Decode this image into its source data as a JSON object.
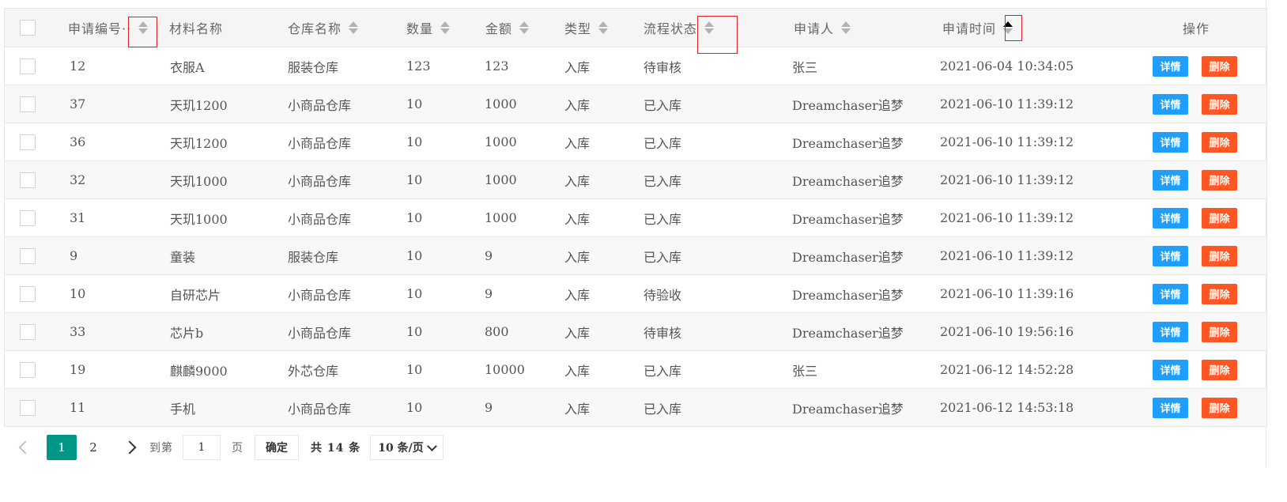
{
  "columns": {
    "id": "申请编号··",
    "material": "材料名称",
    "warehouse": "仓库名称",
    "qty": "数量",
    "amount": "金额",
    "type": "类型",
    "status": "流程状态",
    "applicant": "申请人",
    "time": "申请时间",
    "ops": "操作"
  },
  "rows": [
    {
      "id": "12",
      "material": "衣服A",
      "warehouse": "服装仓库",
      "qty": "123",
      "amount": "123",
      "type": "入库",
      "status": "待审核",
      "applicant": "张三",
      "time": "2021-06-04 10:34:05"
    },
    {
      "id": "37",
      "material": "天玑1200",
      "warehouse": "小商品仓库",
      "qty": "10",
      "amount": "1000",
      "type": "入库",
      "status": "已入库",
      "applicant": "Dreamchaser追梦",
      "time": "2021-06-10 11:39:12"
    },
    {
      "id": "36",
      "material": "天玑1200",
      "warehouse": "小商品仓库",
      "qty": "10",
      "amount": "1000",
      "type": "入库",
      "status": "已入库",
      "applicant": "Dreamchaser追梦",
      "time": "2021-06-10 11:39:12"
    },
    {
      "id": "32",
      "material": "天玑1000",
      "warehouse": "小商品仓库",
      "qty": "10",
      "amount": "1000",
      "type": "入库",
      "status": "已入库",
      "applicant": "Dreamchaser追梦",
      "time": "2021-06-10 11:39:12"
    },
    {
      "id": "31",
      "material": "天玑1000",
      "warehouse": "小商品仓库",
      "qty": "10",
      "amount": "1000",
      "type": "入库",
      "status": "已入库",
      "applicant": "Dreamchaser追梦",
      "time": "2021-06-10 11:39:12"
    },
    {
      "id": "9",
      "material": "童装",
      "warehouse": "服装仓库",
      "qty": "10",
      "amount": "9",
      "type": "入库",
      "status": "已入库",
      "applicant": "Dreamchaser追梦",
      "time": "2021-06-10 11:39:12"
    },
    {
      "id": "10",
      "material": "自研芯片",
      "warehouse": "小商品仓库",
      "qty": "10",
      "amount": "9",
      "type": "入库",
      "status": "待验收",
      "applicant": "Dreamchaser追梦",
      "time": "2021-06-10 11:39:16"
    },
    {
      "id": "33",
      "material": "芯片b",
      "warehouse": "小商品仓库",
      "qty": "10",
      "amount": "800",
      "type": "入库",
      "status": "待审核",
      "applicant": "Dreamchaser追梦",
      "time": "2021-06-10 19:56:16"
    },
    {
      "id": "19",
      "material": "麒麟9000",
      "warehouse": "外芯仓库",
      "qty": "10",
      "amount": "10000",
      "type": "入库",
      "status": "已入库",
      "applicant": "张三",
      "time": "2021-06-12 14:52:28"
    },
    {
      "id": "11",
      "material": "手机",
      "warehouse": "小商品仓库",
      "qty": "10",
      "amount": "9",
      "type": "入库",
      "status": "已入库",
      "applicant": "Dreamchaser追梦",
      "time": "2021-06-12 14:53:18"
    }
  ],
  "actions": {
    "detail": "详情",
    "delete": "删除"
  },
  "pagination": {
    "pages": [
      "1",
      "2"
    ],
    "current": "1",
    "goto_prefix": "到第",
    "goto_value": "1",
    "goto_suffix": "页",
    "confirm": "确定",
    "total": "共 14 条",
    "page_size": "10 条/页"
  },
  "colors": {
    "detail": "#1e9fff",
    "delete": "#ff5722",
    "active_page": "#009688",
    "highlight_box": "#e02020"
  }
}
